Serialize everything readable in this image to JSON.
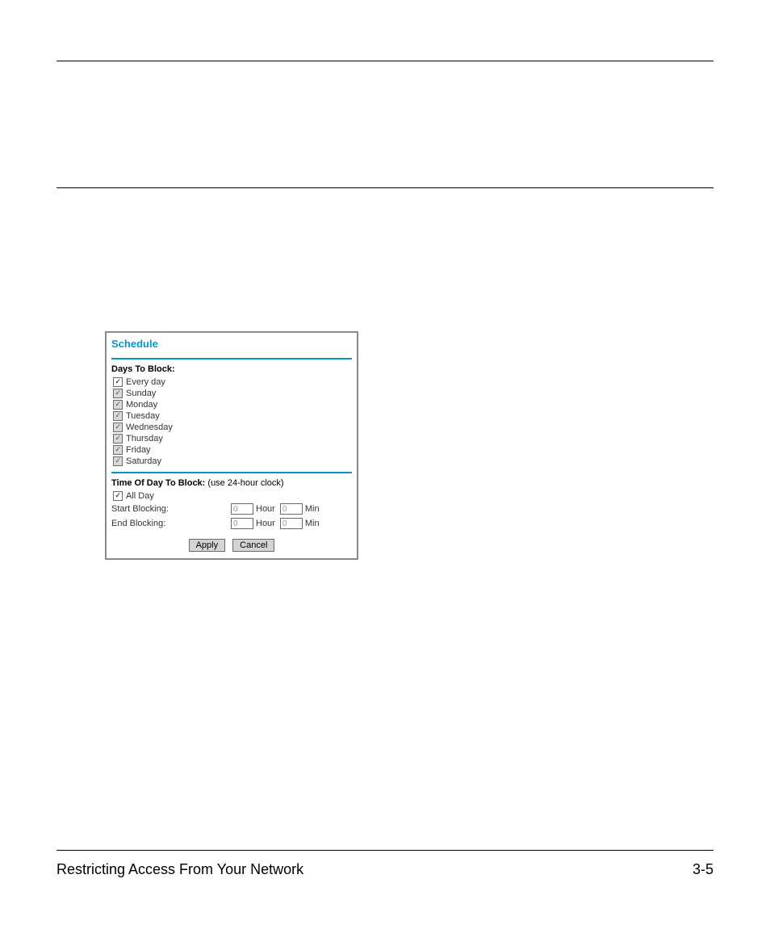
{
  "footer": {
    "left": "Restricting Access From Your Network",
    "right": "3-5"
  },
  "panel": {
    "title": "Schedule",
    "days_label": "Days To Block:",
    "days": {
      "everyday": "Every day",
      "sunday": "Sunday",
      "monday": "Monday",
      "tuesday": "Tuesday",
      "wednesday": "Wednesday",
      "thursday": "Thursday",
      "friday": "Friday",
      "saturday": "Saturday"
    },
    "time_label_bold": "Time Of Day To Block:",
    "time_label_paren": " (use 24-hour clock)",
    "all_day": "All Day",
    "start_label": "Start Blocking:",
    "end_label": "End Blocking:",
    "hour_unit": "Hour",
    "min_unit": "Min",
    "start_hour": "0",
    "start_min": "0",
    "end_hour": "0",
    "end_min": "0",
    "apply": "Apply",
    "cancel": "Cancel"
  }
}
